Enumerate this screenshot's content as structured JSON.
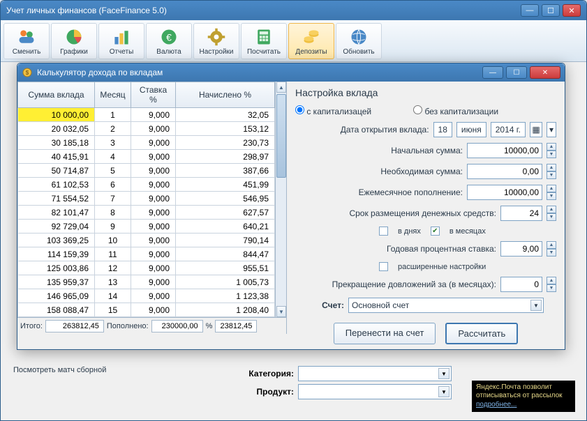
{
  "main": {
    "title": "Учет личных финансов (FaceFinance 5.0)"
  },
  "toolbar": {
    "items": [
      {
        "label": "Сменить",
        "icon": "users-icon"
      },
      {
        "label": "Графики",
        "icon": "chart-pie-icon"
      },
      {
        "label": "Отчеты",
        "icon": "chart-bar-icon"
      },
      {
        "label": "Валюта",
        "icon": "euro-icon"
      },
      {
        "label": "Настройки",
        "icon": "gear-icon"
      },
      {
        "label": "Посчитать",
        "icon": "calculator-icon"
      },
      {
        "label": "Депозиты",
        "icon": "coins-icon",
        "active": true
      },
      {
        "label": "Обновить",
        "icon": "globe-icon"
      }
    ]
  },
  "dialog": {
    "title": "Калькулятор дохода по вкладам",
    "columns": {
      "sum": "Сумма вклада",
      "month": "Месяц",
      "rate": "Ставка %",
      "accrued": "Начислено %"
    },
    "rows": [
      {
        "sum": "10 000,00",
        "month": "1",
        "rate": "9,000",
        "accrued": "32,05",
        "hl": true
      },
      {
        "sum": "20 032,05",
        "month": "2",
        "rate": "9,000",
        "accrued": "153,12"
      },
      {
        "sum": "30 185,18",
        "month": "3",
        "rate": "9,000",
        "accrued": "230,73"
      },
      {
        "sum": "40 415,91",
        "month": "4",
        "rate": "9,000",
        "accrued": "298,97"
      },
      {
        "sum": "50 714,87",
        "month": "5",
        "rate": "9,000",
        "accrued": "387,66"
      },
      {
        "sum": "61 102,53",
        "month": "6",
        "rate": "9,000",
        "accrued": "451,99"
      },
      {
        "sum": "71 554,52",
        "month": "7",
        "rate": "9,000",
        "accrued": "546,95"
      },
      {
        "sum": "82 101,47",
        "month": "8",
        "rate": "9,000",
        "accrued": "627,57"
      },
      {
        "sum": "92 729,04",
        "month": "9",
        "rate": "9,000",
        "accrued": "640,21"
      },
      {
        "sum": "103 369,25",
        "month": "10",
        "rate": "9,000",
        "accrued": "790,14"
      },
      {
        "sum": "114 159,39",
        "month": "11",
        "rate": "9,000",
        "accrued": "844,47"
      },
      {
        "sum": "125 003,86",
        "month": "12",
        "rate": "9,000",
        "accrued": "955,51"
      },
      {
        "sum": "135 959,37",
        "month": "13",
        "rate": "9,000",
        "accrued": "1 005,73"
      },
      {
        "sum": "146 965,09",
        "month": "14",
        "rate": "9,000",
        "accrued": "1 123,38"
      },
      {
        "sum": "158 088,47",
        "month": "15",
        "rate": "9,000",
        "accrued": "1 208,40"
      }
    ],
    "footer": {
      "total_label": "Итого:",
      "total_value": "263812,45",
      "replen_label": "Пополнено:",
      "replen_value": "230000,00",
      "pct_label": "%",
      "pct_value": "23812,45"
    },
    "settings": {
      "title": "Настройка вклада",
      "radio_cap": "с капитализацей",
      "radio_nocap": "без капитализации",
      "open_date_label": "Дата открытия вклада:",
      "date_day": "18",
      "date_month": "июня",
      "date_year": "2014 г.",
      "initial_label": "Начальная сумма:",
      "initial_value": "10000,00",
      "required_label": "Необходимая сумма:",
      "required_value": "0,00",
      "monthly_label": "Ежемесячное пополнение:",
      "monthly_value": "10000,00",
      "term_label": "Срок размещения денежных средств:",
      "term_value": "24",
      "days_label": "в днях",
      "months_label": "в месяцах",
      "rate_label": "Годовая процентная ставка:",
      "rate_value": "9,00",
      "advanced_label": "расширенные настройки",
      "stop_label": "Прекращение довложений за (в месяцах):",
      "stop_value": "0",
      "account_label": "Счет:",
      "account_value": "Основной счет",
      "transfer_btn": "Перенести на счет",
      "calc_btn": "Рассчитать"
    }
  },
  "bottom": {
    "hint": "Посмотреть матч сборной",
    "category_label": "Категория:",
    "product_label": "Продукт:"
  },
  "tooltip": {
    "line1": "Яндекс.Почта позволит",
    "line2": "отписываться от рассылок",
    "link": "подробнее..."
  }
}
